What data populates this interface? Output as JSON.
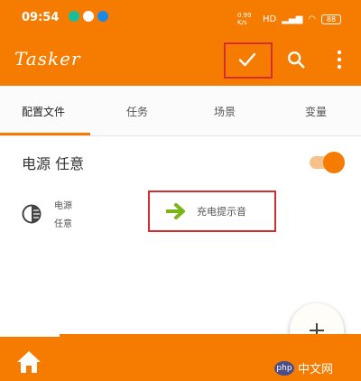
{
  "status_bar": {
    "time": "09:54",
    "network_speed": "0.99 K/s",
    "network_type": "HD",
    "battery": "88"
  },
  "app_bar": {
    "title": "Tasker",
    "confirm_icon": "check-icon",
    "search_icon": "search-icon",
    "more_icon": "more-vert-icon"
  },
  "tabs": [
    {
      "label": "配置文件",
      "active": true
    },
    {
      "label": "任务",
      "active": false
    },
    {
      "label": "场景",
      "active": false
    },
    {
      "label": "变量",
      "active": false
    }
  ],
  "profile": {
    "title": "电源 任意",
    "enabled": true,
    "context_line1": "电源",
    "context_line2": "任意",
    "task_name": "充电提示音"
  },
  "fab_icon": "add-icon",
  "bottom_nav": {
    "home_icon": "home-icon"
  },
  "watermark": {
    "badge": "php",
    "text": "中文网"
  },
  "colors": {
    "primary": "#f57c00",
    "highlight_border": "#d32f2f",
    "task_arrow": "#7cb518"
  }
}
